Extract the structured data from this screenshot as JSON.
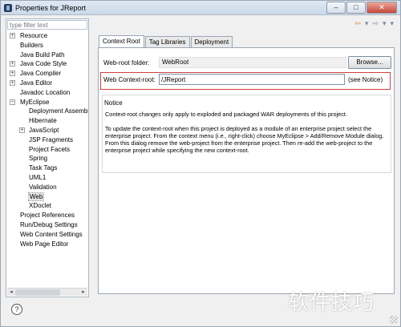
{
  "window": {
    "title": "Properties for JReport",
    "minimize_glyph": "–",
    "maximize_glyph": "□",
    "close_glyph": "✕"
  },
  "filter": {
    "placeholder": "type filter text"
  },
  "tree": {
    "items": [
      {
        "label": "Resource",
        "level": 0,
        "expander": "+"
      },
      {
        "label": "Builders",
        "level": 0
      },
      {
        "label": "Java Build Path",
        "level": 0
      },
      {
        "label": "Java Code Style",
        "level": 0,
        "expander": "+"
      },
      {
        "label": "Java Compiler",
        "level": 0,
        "expander": "+"
      },
      {
        "label": "Java Editor",
        "level": 0,
        "expander": "+"
      },
      {
        "label": "Javadoc Location",
        "level": 0
      },
      {
        "label": "MyEclipse",
        "level": 0,
        "expander": "−"
      },
      {
        "label": "Deployment Assembl",
        "level": 1
      },
      {
        "label": "Hibernate",
        "level": 1
      },
      {
        "label": "JavaScript",
        "level": 1,
        "expander": "+"
      },
      {
        "label": "JSP Fragments",
        "level": 1
      },
      {
        "label": "Project Facets",
        "level": 1
      },
      {
        "label": "Spring",
        "level": 1
      },
      {
        "label": "Task Tags",
        "level": 1
      },
      {
        "label": "UML1",
        "level": 1
      },
      {
        "label": "Validation",
        "level": 1
      },
      {
        "label": "Web",
        "level": 1,
        "selected": true
      },
      {
        "label": "XDoclet",
        "level": 1
      },
      {
        "label": "Project References",
        "level": 0
      },
      {
        "label": "Run/Debug Settings",
        "level": 0
      },
      {
        "label": "Web Content Settings",
        "level": 0
      },
      {
        "label": "Web Page Editor",
        "level": 0
      }
    ]
  },
  "nav_icons": {
    "back": "⇦",
    "back_menu": "▾",
    "forward": "⇨",
    "forward_menu": "▾",
    "view_menu": "▾"
  },
  "tabs": [
    {
      "label": "Context Root",
      "active": true
    },
    {
      "label": "Tag Libraries"
    },
    {
      "label": "Deployment"
    }
  ],
  "form": {
    "web_root_label": "Web-root folder:",
    "web_root_value": "WebRoot",
    "browse_label": "Browse...",
    "context_root_label": "Web Context-root:",
    "context_root_value": "/JReport",
    "see_notice": "(see Notice)"
  },
  "notice": {
    "legend": "Notice",
    "paragraph1": "Context-root changes only apply to exploded and packaged WAR deployments of this project.",
    "paragraph2": "To update the context-root when this project is deployed as a module of an enterprise project select the enterprise project. From the context menu (i.e., right-click) choose MyEclipse > Add/Remove Module dialog. From this dialog remove the web-project from the enterprise project. Then re-add the web-project to the enterprise project while specifying the new context-root."
  },
  "help": {
    "glyph": "?"
  },
  "scroll": {
    "left": "◂",
    "right": "▸"
  },
  "watermark": "软件技巧"
}
